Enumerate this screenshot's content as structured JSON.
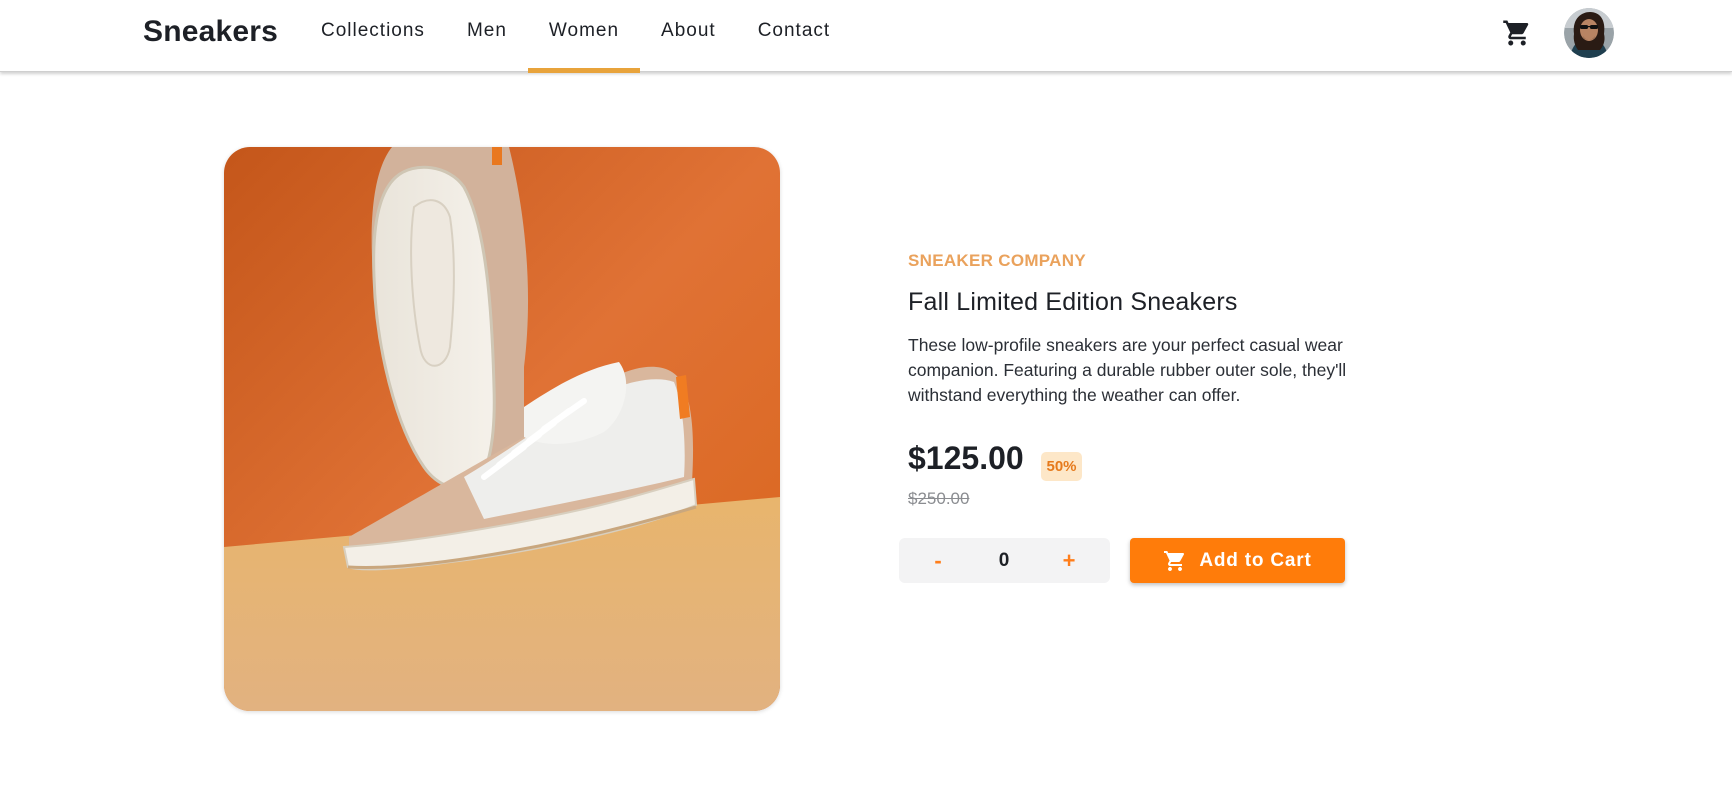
{
  "header": {
    "logo": "Sneakers",
    "nav": [
      {
        "label": "Collections",
        "active": false
      },
      {
        "label": "Men",
        "active": false
      },
      {
        "label": "Women",
        "active": true
      },
      {
        "label": "About",
        "active": false
      },
      {
        "label": "Contact",
        "active": false
      }
    ],
    "cart_icon": "cart-icon",
    "avatar_icon": "user-avatar"
  },
  "product": {
    "company": "SNEAKER COMPANY",
    "title": "Fall Limited Edition Sneakers",
    "description": "These low-profile sneakers are your perfect casual wear companion. Featuring a durable rubber outer sole, they'll withstand everything the weather can offer.",
    "price": "$125.00",
    "discount": "50%",
    "original_price": "$250.00",
    "image": "sneaker-photo"
  },
  "quantity": {
    "minus": "-",
    "value": "0",
    "plus": "+"
  },
  "add_to_cart": {
    "label": "Add to Cart",
    "icon": "cart-icon"
  },
  "colors": {
    "accent": "#ff7c0a",
    "company_text": "#eaa25c",
    "nav_active_underline": "#e8a33b",
    "discount_bg": "#fde7c8"
  }
}
